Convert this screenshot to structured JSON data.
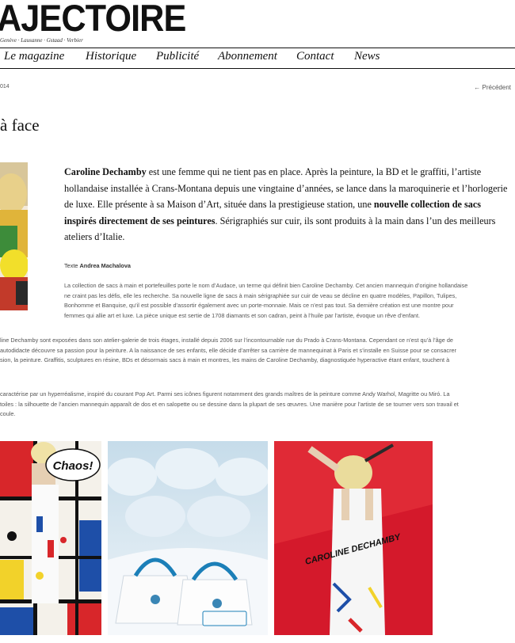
{
  "header": {
    "logo_text": "AJECTOIRE",
    "tagline": "Genève · Lausanne · Gstaad · Verbier"
  },
  "nav": {
    "items": [
      {
        "label": "Le magazine"
      },
      {
        "label": "Historique"
      },
      {
        "label": "Publicité"
      },
      {
        "label": "Abonnement"
      },
      {
        "label": "Contact"
      },
      {
        "label": "News"
      }
    ]
  },
  "article": {
    "date": "014",
    "prev_link": "← Précédent",
    "title": "à face",
    "lead": {
      "p1_bold": "Caroline Dechamby",
      "p1": " est une femme qui ne tient pas en place. Après la peinture, la BD et le graffiti, l’artiste hollandaise installée à Crans-Montana depuis une vingtaine d’années, se lance dans la maroquinerie et l’horlogerie de luxe. Elle présente à sa Maison d’Art, située dans la prestigieuse station, une ",
      "p2_bold": "nouvelle collection de sacs inspirés directement de ses peintures",
      "p3": ". Sérigraphiés sur cuir, ils sont produits à la main dans l’un des meilleurs ateliers d’Italie."
    },
    "credit_prefix": "Texte ",
    "credit_author": "Andrea Machalova",
    "body1": [
      "La collection de sacs à main et portefeuilles porte le nom d’Audace, un terme qui définit bien Caroline Dechamby. Cet ancien mannequin d’origine hollandaise",
      "ne craint pas les défis, elle les recherche. Sa nouvelle ligne de sacs à main sérigraphiée sur cuir de veau se décline en quatre modèles, Papillon, Tulipes,",
      "Bonhomme et Banquise, qu’il est possible d’assortir également avec un porte-monnaie. Mais ce n’est pas tout. Sa dernière création est une montre pour",
      "femmes qui allie art et luxe. La pièce unique est sertie de 1708 diamants et son cadran, peint à l’huile par l’artiste, évoque un rêve d’enfant."
    ],
    "body2": [
      "line Dechamby sont exposées dans son atelier-galerie de trois étages, installé depuis 2006 sur l’incontournable rue du Prado à Crans-Montana. Cependant ce n’est qu’à l’âge de",
      "autodidacte découvre sa passion pour la peinture. A la naissance de ses enfants, elle décide d’arrêter sa carrière de mannequinat à Paris et s’installe en Suisse pour se consacrer",
      "sion, la peinture. Graffitis, sculptures en résine, BDs et désormais sacs à main et montres, les mains de Caroline Dechamby, diagnostiquée hyperactive étant enfant, touchent à"
    ],
    "body3": [
      "caractérise par un hyperréalisme, inspiré du courant Pop Art. Parmi ses icônes figurent notamment des grands maîtres de la peinture comme Andy Warhol, Magritte ou Miró. La",
      "toiles : la silhouette de l’ancien mannequin apparaît de dos et en salopette ou se dessine dans la plupart de ses œuvres. Une manière pour l’artiste de se tourner vers son travail et",
      "coule."
    ]
  },
  "gallery": {
    "image1_text": "Chaos!",
    "image3_text": "CAROLINE DECHAMBY"
  }
}
